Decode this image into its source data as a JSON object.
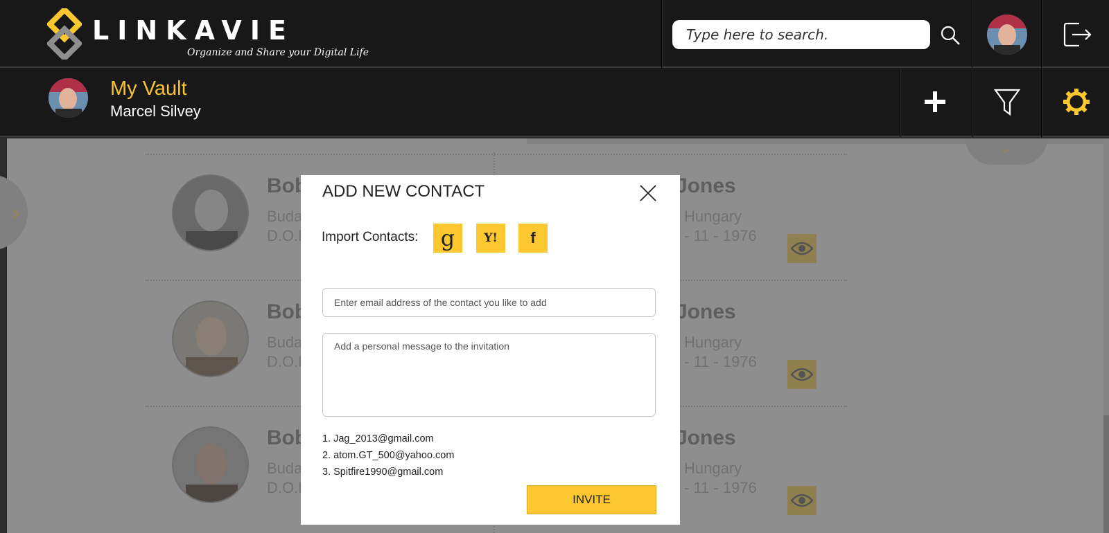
{
  "header": {
    "logo_text": "LINKAVIE",
    "tagline": "Organize and Share your Digital Life",
    "search_placeholder": "Type here to search."
  },
  "vault": {
    "title": "My Vault",
    "user_name": "Marcel Silvey"
  },
  "contacts_background": [
    {
      "name_left": "Bob",
      "city_left": "Buda",
      "dob_left": "D.O.E",
      "name_right": "Jones",
      "location_right": "Hungary",
      "date_right": "- 11 - 1976"
    },
    {
      "name_left": "Bob",
      "city_left": "Buda",
      "dob_left": "D.O.E",
      "name_right": "Jones",
      "location_right": "Hungary",
      "date_right": "- 11 - 1976"
    },
    {
      "name_left": "Bob",
      "city_left": "Buda",
      "dob_left": "D.O.E",
      "name_right": "Jones",
      "location_right": "Hungary",
      "date_right": "- 11 - 1976"
    }
  ],
  "modal": {
    "title": "ADD NEW CONTACT",
    "import_label": "Import Contacts:",
    "import_google": "g",
    "import_yahoo": "Y!",
    "import_facebook": "f",
    "email_placeholder": "Enter email address of the contact you like to add",
    "message_placeholder": "Add a personal message to the invitation",
    "invitees": [
      "1.  Jag_2013@gmail.com",
      "2.  atom.GT_500@yahoo.com",
      "3.  Spitfire1990@gmail.com"
    ],
    "invite_label": "INVITE"
  },
  "colors": {
    "accent": "#fcc72f",
    "topbar": "#181818",
    "vault_title": "#f7c232"
  },
  "icons": [
    "logo-icon",
    "search-icon",
    "logout-icon",
    "plus-icon",
    "filter-icon",
    "gear-icon",
    "eye-icon",
    "close-icon",
    "chevron-right-icon",
    "chevron-down-icon",
    "google-icon",
    "yahoo-icon",
    "facebook-icon"
  ]
}
